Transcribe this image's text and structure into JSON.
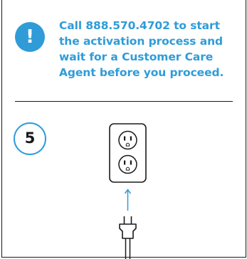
{
  "notice": {
    "icon": "exclamation-icon",
    "icon_glyph": "!",
    "accent_color": "#2f9cd8",
    "lines": [
      "Call 888.570.4702 to start",
      "the activation process and",
      "wait for a Customer Care",
      "Agent before you proceed."
    ]
  },
  "step": {
    "number": "5"
  },
  "illustration": {
    "outlet": "wall-outlet-icon",
    "arrow": "arrow-up-icon",
    "plug": "power-plug-icon"
  }
}
